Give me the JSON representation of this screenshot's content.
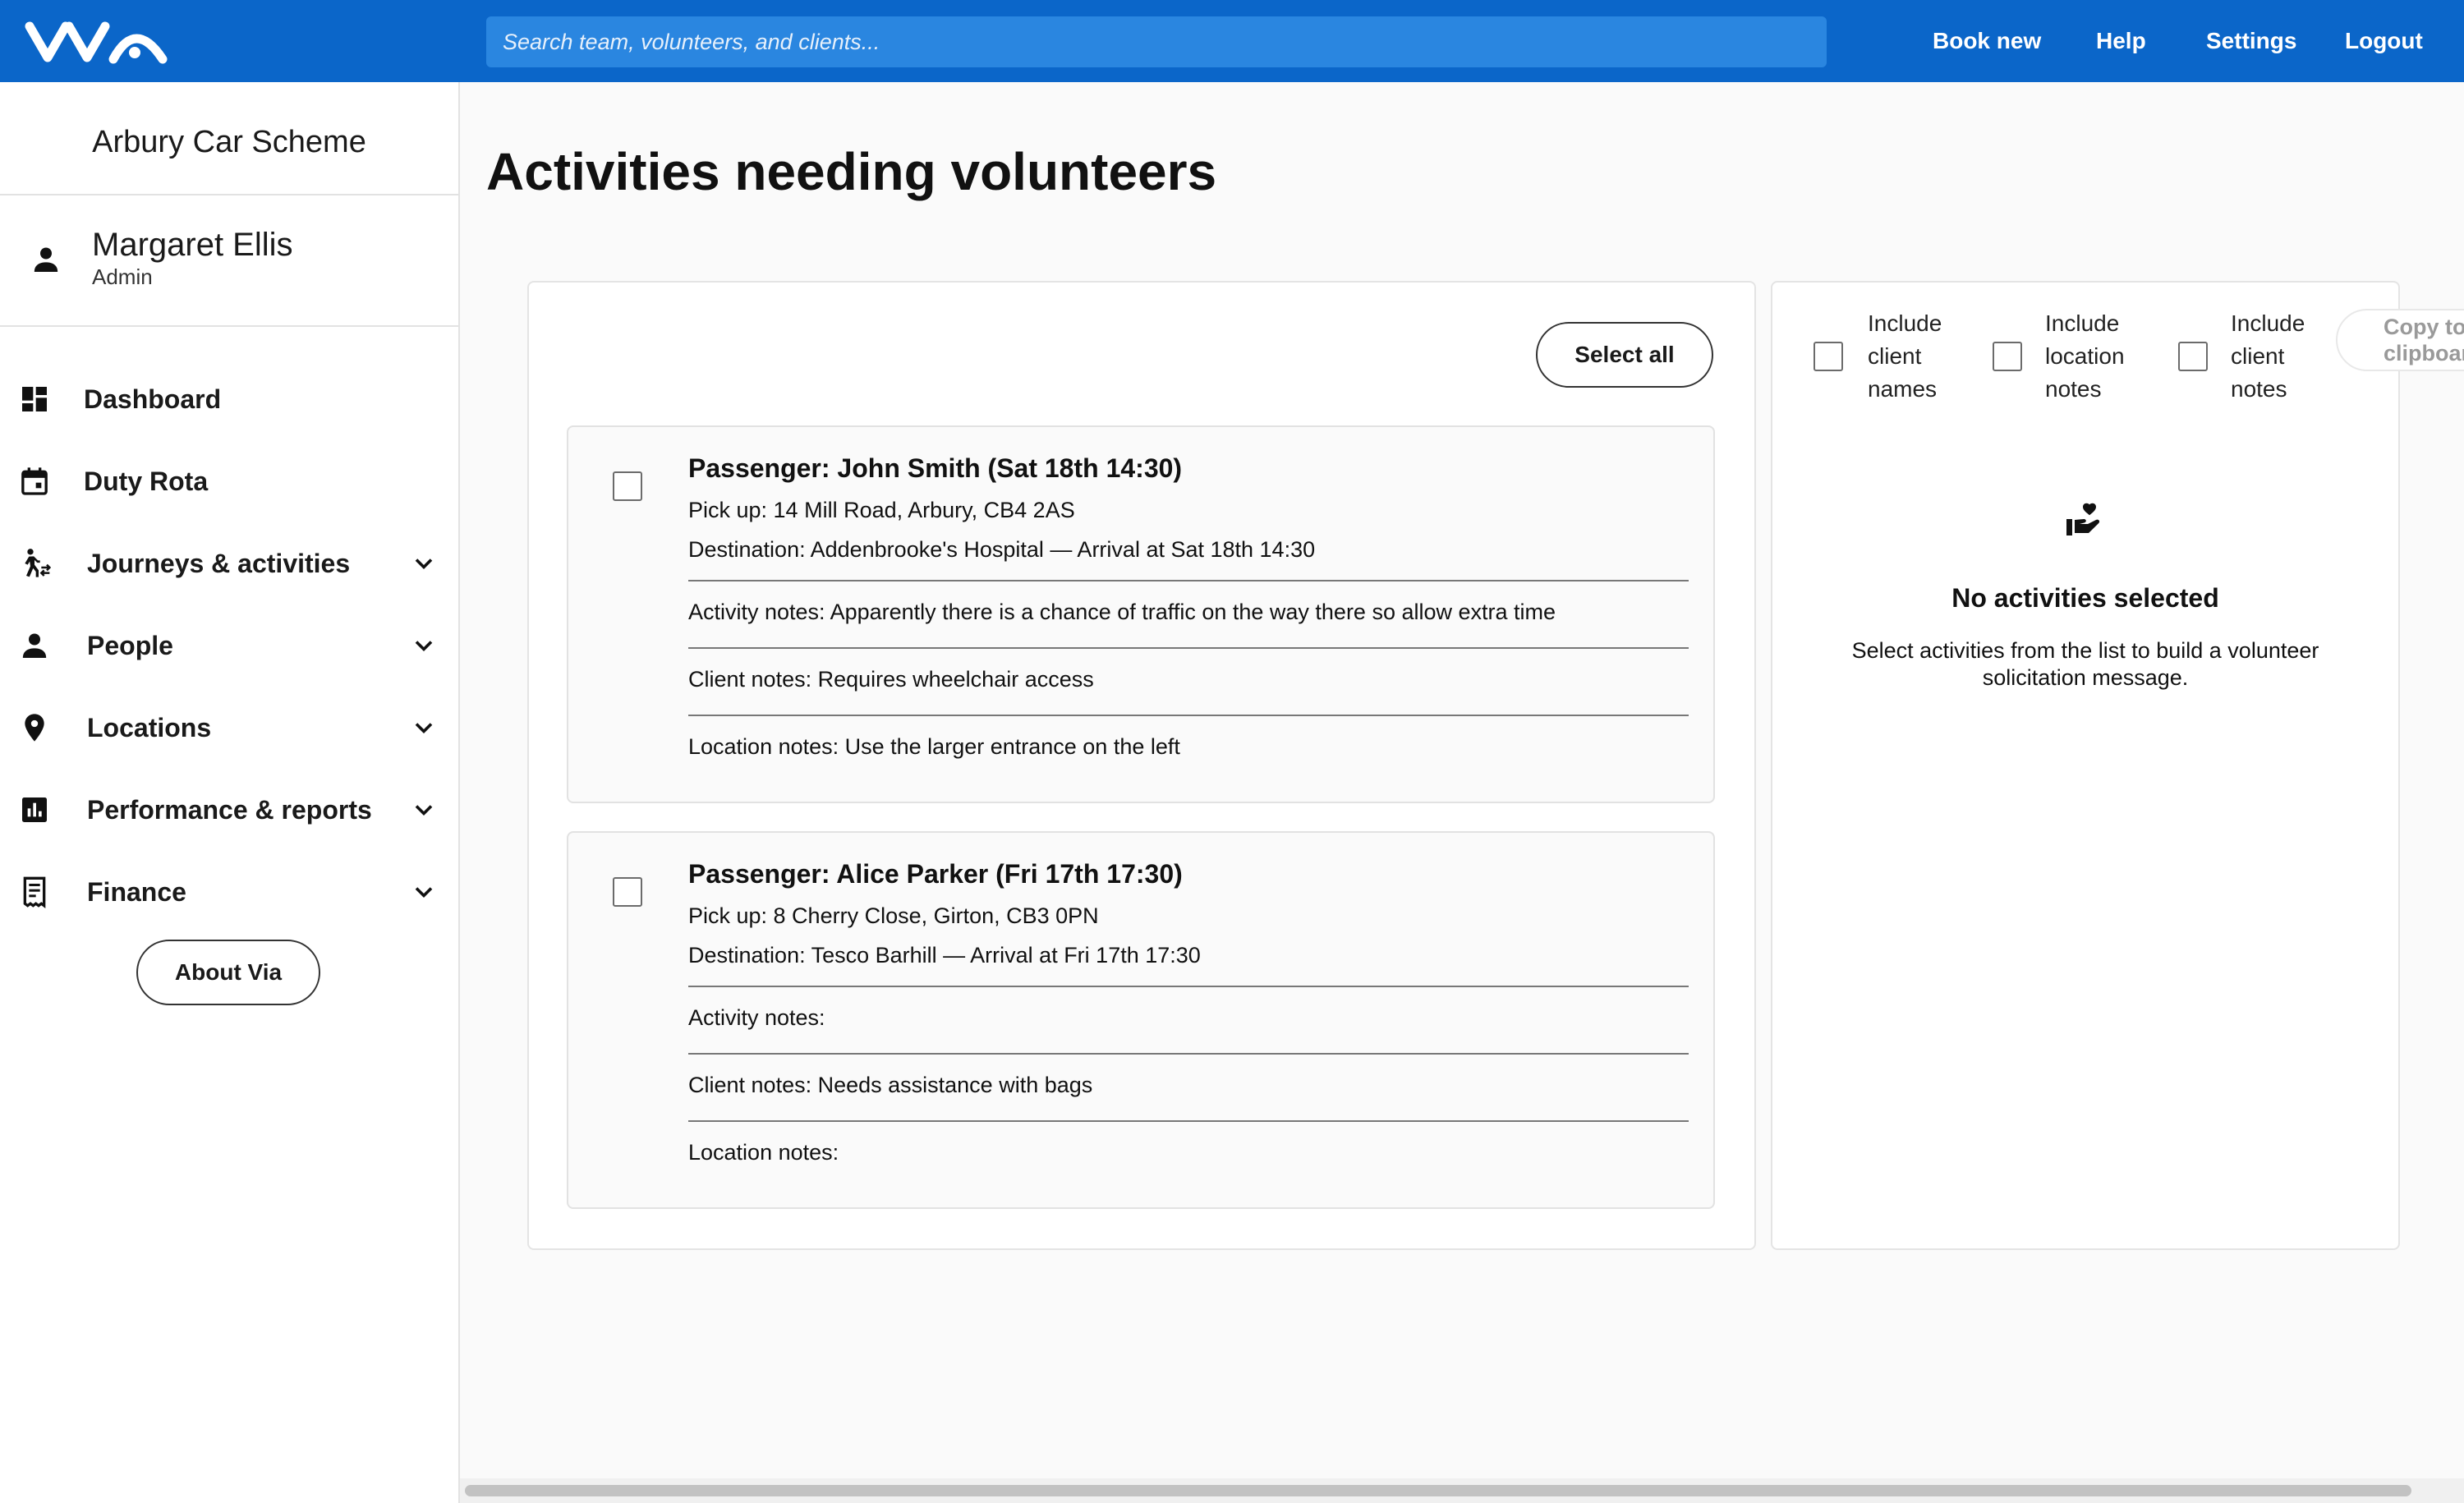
{
  "header": {
    "search_placeholder": "Search team, volunteers, and clients...",
    "nav": [
      {
        "label": "Book new"
      },
      {
        "label": "Help"
      },
      {
        "label": "Settings"
      },
      {
        "label": "Logout"
      }
    ],
    "colors": {
      "bar": "#0b66c9",
      "search": "#2a86e0"
    }
  },
  "sidebar": {
    "org_name": "Arbury Car Scheme",
    "user": {
      "name": "Margaret Ellis",
      "role": "Admin"
    },
    "items": [
      {
        "label": "Dashboard",
        "icon": "dashboard-icon",
        "expandable": false
      },
      {
        "label": "Duty Rota",
        "icon": "calendar-icon",
        "expandable": false
      },
      {
        "label": "Journeys & activities",
        "icon": "walking-icon",
        "expandable": true
      },
      {
        "label": "People",
        "icon": "person-icon",
        "expandable": true
      },
      {
        "label": "Locations",
        "icon": "location-pin-icon",
        "expandable": true
      },
      {
        "label": "Performance & reports",
        "icon": "bar-chart-icon",
        "expandable": true
      },
      {
        "label": "Finance",
        "icon": "receipt-icon",
        "expandable": true
      }
    ],
    "about_label": "About Via"
  },
  "main": {
    "title": "Activities needing volunteers",
    "select_all_label": "Select all",
    "activities": [
      {
        "title": "Passenger: John Smith (Sat 18th 14:30)",
        "pickup": "Pick up: 14 Mill Road, Arbury, CB4 2AS",
        "destination": "Destination: Addenbrooke's Hospital — Arrival at Sat 18th 14:30",
        "activity_notes": "Activity notes: Apparently there is a chance of traffic on the way there so allow extra time",
        "client_notes": "Client notes: Requires wheelchair access",
        "location_notes": "Location notes: Use the larger entrance on the left",
        "checked": false
      },
      {
        "title": "Passenger: Alice Parker (Fri 17th 17:30)",
        "pickup": "Pick up: 8 Cherry Close, Girton, CB3 0PN",
        "destination": "Destination: Tesco Barhill — Arrival at Fri 17th 17:30",
        "activity_notes": "Activity notes:",
        "client_notes": "Client notes: Needs assistance with bags",
        "location_notes": "Location notes:",
        "checked": false
      }
    ]
  },
  "message_panel": {
    "options": [
      {
        "label": "Include client names",
        "checked": false
      },
      {
        "label": "Include location notes",
        "checked": false
      },
      {
        "label": "Include client notes",
        "checked": false
      }
    ],
    "copy_label": "Copy to clipboard",
    "empty_icon": "volunteer-hand-heart-icon",
    "empty_title": "No activities selected",
    "empty_text": "Select activities from the list to build a volunteer solicitation message."
  }
}
